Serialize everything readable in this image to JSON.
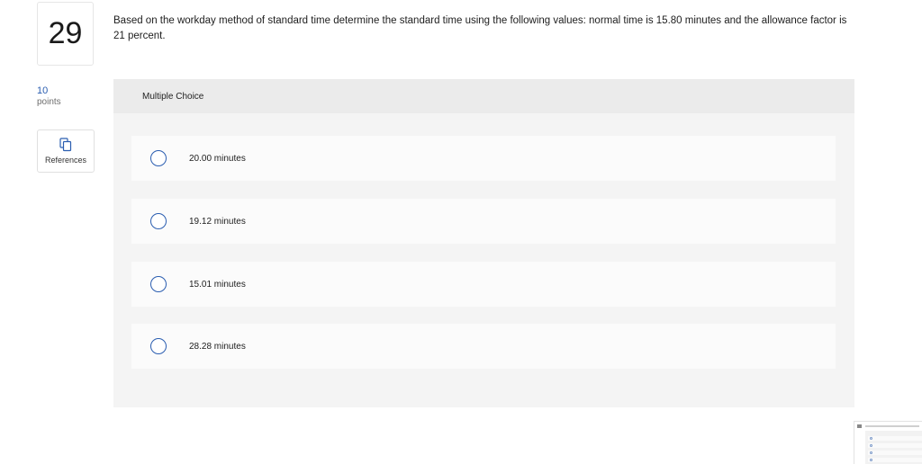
{
  "question": {
    "number": "29",
    "points_value": "10",
    "points_label": "points",
    "text": "Based on the workday method of standard time determine the standard time using the following values: normal time is 15.80 minutes and the allowance factor is 21 percent."
  },
  "references": {
    "label": "References",
    "icon": "copy-icon"
  },
  "answer_panel": {
    "header": "Multiple Choice",
    "options": [
      {
        "label": "20.00 minutes"
      },
      {
        "label": "19.12 minutes"
      },
      {
        "label": "15.01 minutes"
      },
      {
        "label": "28.28 minutes"
      }
    ]
  },
  "colors": {
    "accent": "#2a5db0",
    "panel_bg": "#f4f4f4",
    "header_bg": "#ebebeb",
    "option_bg": "#fbfbfb"
  }
}
